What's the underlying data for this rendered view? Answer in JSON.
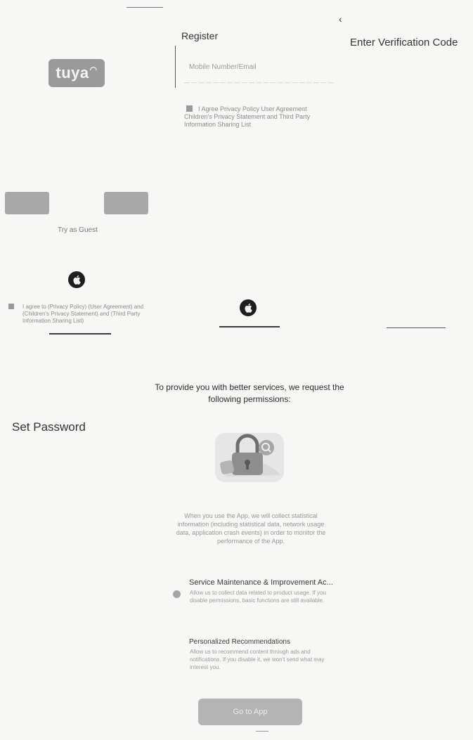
{
  "logo": {
    "text": "tuya"
  },
  "register": {
    "title": "Register",
    "account_placeholder": "Mobile Number/Email",
    "agreement": "I Agree Privacy Policy User Agreement Children's Privacy Statement and Third Party Information Sharing List"
  },
  "verification": {
    "back_icon": "chevron-left-icon",
    "title": "Enter Verification Code"
  },
  "guest": {
    "try_as_guest": "Try as Guest",
    "agreement": "I agree to (Privacy Policy) (User Agreement) and (Children's Privacy Statement) and (Third Party Information Sharing List)"
  },
  "set_password": {
    "title": "Set Password"
  },
  "permissions": {
    "title": "To provide you with better services, we request the following permissions:",
    "description": "When you use the App, we will collect statistical information (including statistical data, network usage data, application crash events) in order to monitor the performance of the App.",
    "items": [
      {
        "title": "Service Maintenance & Improvement Ac...",
        "description": "Allow us to collect data related to product usage. If you disable permissions, basic functions are still available."
      },
      {
        "title": "Personalized Recommendations",
        "description": "Allow us to recommend content through ads and notifications. If you disable it, we won't send what may interest you."
      }
    ],
    "go_to_app": "Go to App"
  },
  "icons": {
    "apple": "apple-icon",
    "lock": "lock-illustration"
  },
  "colors": {
    "button_gray": "#a8a8a8",
    "text_dark": "#333333"
  }
}
